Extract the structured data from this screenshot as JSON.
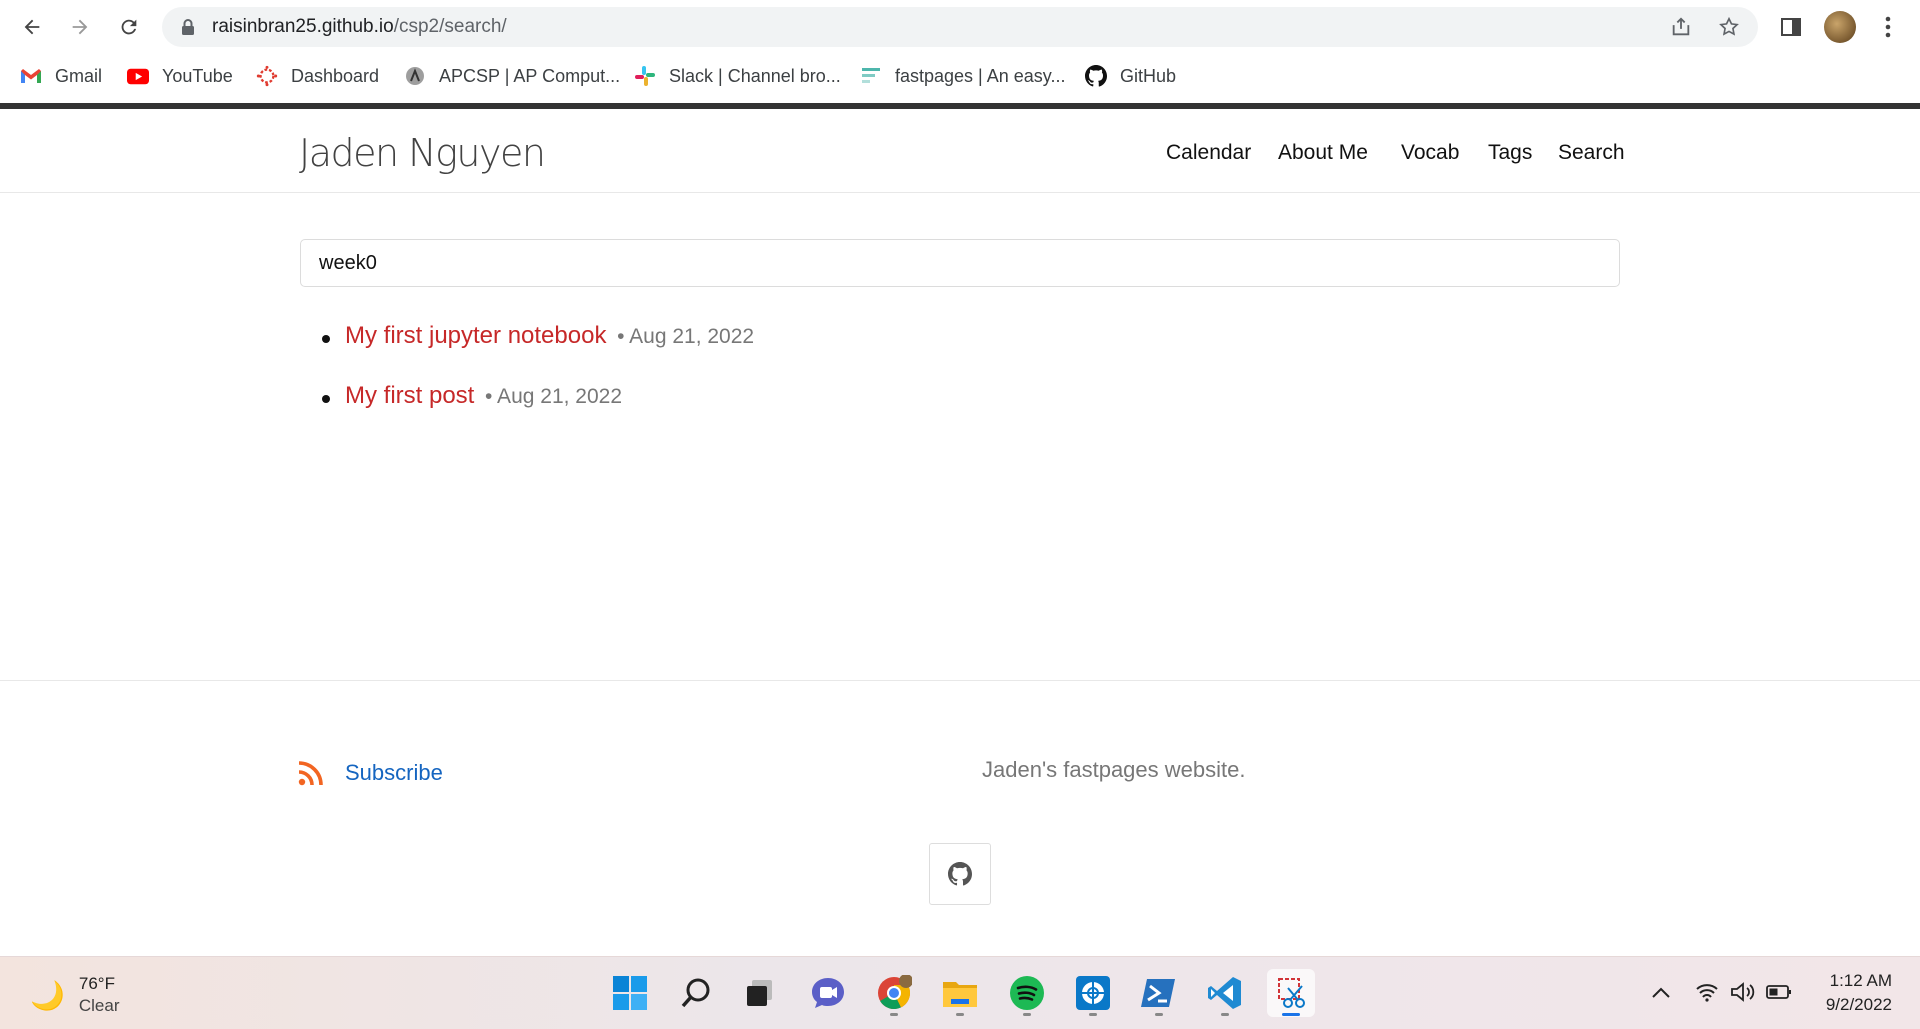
{
  "browser": {
    "url_host": "raisinbran25.github.io",
    "url_path": "/csp2/search/",
    "bookmarks": [
      {
        "label": "Gmail",
        "icon": "gmail-icon"
      },
      {
        "label": "YouTube",
        "icon": "youtube-icon"
      },
      {
        "label": "Dashboard",
        "icon": "canvas-icon"
      },
      {
        "label": "APCSP | AP Comput...",
        "icon": "apcsp-icon"
      },
      {
        "label": "Slack | Channel bro...",
        "icon": "slack-icon"
      },
      {
        "label": "fastpages | An easy...",
        "icon": "fastpages-icon"
      },
      {
        "label": "GitHub",
        "icon": "github-icon"
      }
    ]
  },
  "site": {
    "title": "Jaden Nguyen",
    "nav": [
      "Calendar",
      "About Me",
      "Vocab",
      "Tags",
      "Search"
    ]
  },
  "search": {
    "query": "week0"
  },
  "results": [
    {
      "title": "My first jupyter notebook",
      "date": "• Aug 21, 2022"
    },
    {
      "title": "My first post",
      "date": "• Aug 21, 2022"
    }
  ],
  "footer": {
    "subscribe": "Subscribe",
    "description": "Jaden's fastpages website."
  },
  "taskbar": {
    "temperature": "76°F",
    "condition": "Clear",
    "time": "1:12 AM",
    "date": "9/2/2022",
    "apps": [
      "start-icon",
      "search-icon",
      "task-view-icon",
      "teams-chat-icon",
      "chrome-icon",
      "file-explorer-icon",
      "spotify-icon",
      "network-app-icon",
      "powershell-icon",
      "vscode-icon",
      "snipping-tool-icon"
    ]
  },
  "colors": {
    "link_red": "#c62828",
    "link_blue": "#1565c0",
    "rss_orange": "#f26522"
  }
}
